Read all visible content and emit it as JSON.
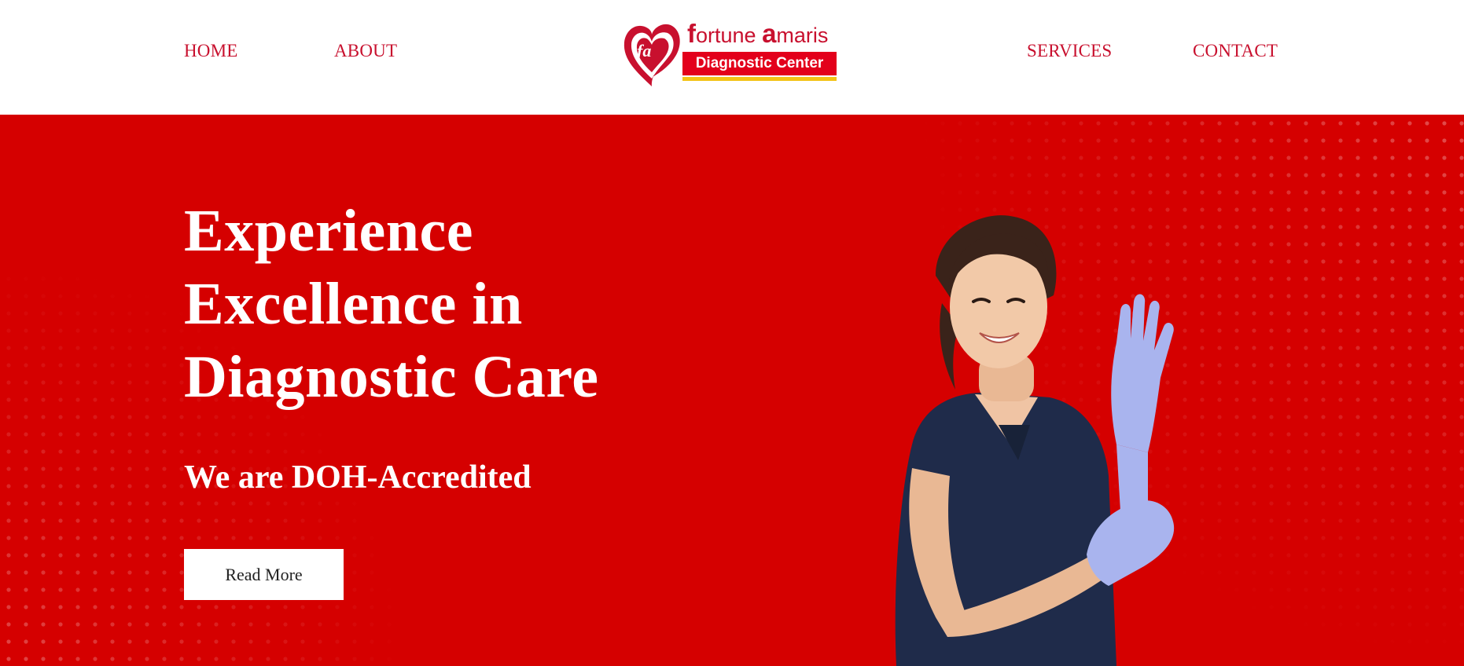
{
  "header": {
    "nav_left": [
      {
        "label": "HOME"
      },
      {
        "label": "ABOUT"
      }
    ],
    "nav_right": [
      {
        "label": "SERVICES"
      },
      {
        "label": "CONTACT"
      }
    ],
    "logo": {
      "monogram": "fa",
      "brand_first_letter": "f",
      "brand_first_rest": "ortune ",
      "brand_second_letter": "a",
      "brand_second_rest": "maris",
      "subtitle": "Diagnostic Center"
    }
  },
  "hero": {
    "title": "Experience Excellence in Diagnostic Care",
    "subtitle": "We are DOH-Accredited",
    "cta_label": "Read More"
  },
  "colors": {
    "brand_red": "#c8102e",
    "hero_background": "#d50000",
    "logo_bar_red": "#e3001b",
    "logo_underline_yellow": "#f3c316",
    "scrubs_navy": "#1f2b4a",
    "glove_lavender": "#a9b4ee"
  }
}
